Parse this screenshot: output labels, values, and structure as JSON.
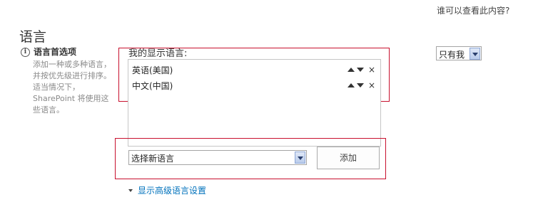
{
  "visibility": {
    "question": "谁可以查看此内容?",
    "selected": "只有我"
  },
  "section": {
    "title": "语言",
    "info_icon": "i",
    "pref_heading": "语言首选项",
    "pref_description": "添加一种或多种语言，并按优先级进行排序。适当情况下，SharePoint 将使用这些语言。"
  },
  "display_languages": {
    "label": "我的显示语言:",
    "items": [
      {
        "name": "英语(美国)",
        "remove": "×"
      },
      {
        "name": "中文(中国)",
        "remove": "×"
      }
    ]
  },
  "add_language": {
    "select_value": "选择新语言",
    "add_button": "添加"
  },
  "advanced_link": "显示高级语言设置",
  "icons": {
    "info": "info-icon",
    "move_up": "triangle-up-icon",
    "move_down": "triangle-down-icon",
    "remove": "close-icon",
    "dropdown": "chevron-down-icon",
    "expand": "caret-down-icon"
  },
  "colors": {
    "highlight_frame": "#c8102e",
    "link": "#0072bc"
  }
}
